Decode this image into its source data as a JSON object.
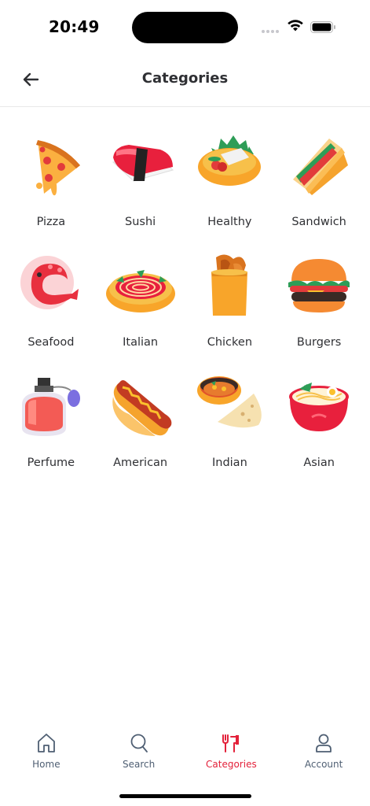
{
  "status_bar": {
    "time": "20:49"
  },
  "header": {
    "title": "Categories"
  },
  "categories": [
    {
      "label": "Pizza",
      "icon": "pizza-icon"
    },
    {
      "label": "Sushi",
      "icon": "sushi-icon"
    },
    {
      "label": "Healthy",
      "icon": "healthy-icon"
    },
    {
      "label": "Sandwich",
      "icon": "sandwich-icon"
    },
    {
      "label": "Seafood",
      "icon": "seafood-icon"
    },
    {
      "label": "Italian",
      "icon": "italian-icon"
    },
    {
      "label": "Chicken",
      "icon": "chicken-icon"
    },
    {
      "label": "Burgers",
      "icon": "burger-icon"
    },
    {
      "label": "Perfume",
      "icon": "perfume-icon"
    },
    {
      "label": "American",
      "icon": "hotdog-icon"
    },
    {
      "label": "Indian",
      "icon": "indian-icon"
    },
    {
      "label": "Asian",
      "icon": "ramen-icon"
    }
  ],
  "bottom_nav": {
    "items": [
      {
        "label": "Home",
        "icon": "home-icon",
        "active": false
      },
      {
        "label": "Search",
        "icon": "search-icon",
        "active": false
      },
      {
        "label": "Categories",
        "icon": "cutlery-icon",
        "active": true
      },
      {
        "label": "Account",
        "icon": "account-icon",
        "active": false
      }
    ]
  },
  "colors": {
    "accent": "#e3213a",
    "nav_inactive": "#4f5f73",
    "text": "#2f3034"
  }
}
